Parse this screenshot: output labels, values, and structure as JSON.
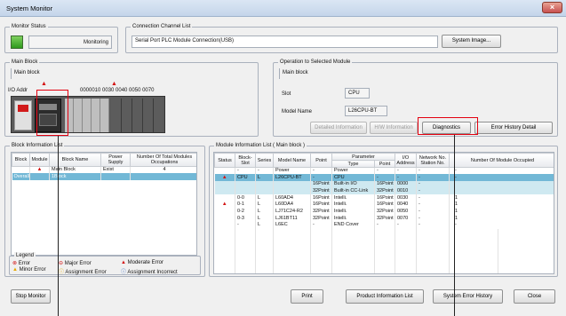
{
  "window": {
    "title": "System Monitor",
    "close_glyph": "×"
  },
  "monitor_status": {
    "label": "Monitor Status",
    "state": "Monitoring"
  },
  "connection": {
    "label": "Connection Channel List",
    "value": "Serial Port  PLC Module Connection(USB)",
    "system_image_button": "System Image..."
  },
  "main_block": {
    "label": "Main Block",
    "field": "Main block",
    "io_address_prefix": "I/O Addr",
    "io_address": "0000010 0030 0040 0050 0070"
  },
  "operation": {
    "label": "Operation to Selected Module",
    "field": "Main block",
    "slot_label": "Slot",
    "slot_value": "CPU",
    "model_label": "Model Name",
    "model_value": "L26CPU-BT",
    "buttons": {
      "detailed": "Detailed Information",
      "hw": "H/W Information",
      "diagnostics": "Diagnostics",
      "error_history": "Error History Detail"
    }
  },
  "block_list": {
    "label": "Block Information List",
    "headers": [
      "Block",
      "Module",
      "Block Name",
      "Power Supply",
      "Number Of Total Modules Occupations"
    ],
    "rows": [
      {
        "block": "",
        "module": "warn",
        "name": "Main Block",
        "supply": "Exist",
        "total": "4"
      },
      {
        "block": "Overall",
        "module": "",
        "name": "1Block",
        "supply": "",
        "total": ""
      }
    ]
  },
  "module_list": {
    "label": "Module Information List ( Main block )",
    "headers": {
      "status": "Status",
      "block_slot": "Block-Slot",
      "series": "Series",
      "model": "Model Name",
      "point": "Point",
      "parameter": "Parameter",
      "type": "Type",
      "param_point": "Point",
      "io_address": "I/O Address",
      "network_no": "Network No. Station No.",
      "occupied": "Number Of Module Occupied"
    },
    "rows": [
      {
        "status": "",
        "slot": "-",
        "series": "-",
        "model": "Power",
        "point": "-",
        "type": "Power",
        "ppoint": "-",
        "io": "-",
        "net": "-",
        "occ": "-",
        "style": ""
      },
      {
        "status": "warn",
        "slot": "CPU",
        "series": "L",
        "model": "L26CPU-BT",
        "point": "-",
        "type": "CPU",
        "ppoint": "-",
        "io": "-",
        "net": "-",
        "occ": "-",
        "style": "sel"
      },
      {
        "status": "",
        "slot": "",
        "series": "",
        "model": "",
        "point": "16Point",
        "type": "Built-in I/O",
        "ppoint": "16Point",
        "io": "0000",
        "net": "-",
        "occ": "",
        "style": "err"
      },
      {
        "status": "",
        "slot": "",
        "series": "",
        "model": "",
        "point": "32Point",
        "type": "Built-in CC-Link",
        "ppoint": "32Point",
        "io": "0010",
        "net": "-",
        "occ": "",
        "style": "err"
      },
      {
        "status": "",
        "slot": "0-0",
        "series": "L",
        "model": "L60AD4",
        "point": "16Point",
        "type": "Intelli.",
        "ppoint": "16Point",
        "io": "0030",
        "net": "-",
        "occ": "1",
        "style": ""
      },
      {
        "status": "warn",
        "slot": "0-1",
        "series": "L",
        "model": "L60DA4",
        "point": "16Point",
        "type": "Intelli.",
        "ppoint": "16Point",
        "io": "0040",
        "net": "-",
        "occ": "1",
        "style": ""
      },
      {
        "status": "",
        "slot": "0-2",
        "series": "L",
        "model": "LJ71C24-R2",
        "point": "32Point",
        "type": "Intelli.",
        "ppoint": "32Point",
        "io": "0050",
        "net": "-",
        "occ": "1",
        "style": ""
      },
      {
        "status": "",
        "slot": "0-3",
        "series": "L",
        "model": "LJ61BT11",
        "point": "32Point",
        "type": "Intelli.",
        "ppoint": "32Point",
        "io": "0070",
        "net": "-",
        "occ": "1",
        "style": ""
      },
      {
        "status": "",
        "slot": "-",
        "series": "L",
        "model": "L6EC",
        "point": "-",
        "type": "END Cover",
        "ppoint": "-",
        "io": "-",
        "net": "-",
        "occ": "-",
        "style": ""
      }
    ]
  },
  "legend": {
    "label": "Legend",
    "items": [
      {
        "text": "Error",
        "icon": "error-icon"
      },
      {
        "text": "Major Error",
        "icon": "major-error-icon"
      },
      {
        "text": "Moderate Error",
        "icon": "moderate-error-icon"
      },
      {
        "text": "Minor Error",
        "icon": "minor-error-icon"
      },
      {
        "text": "Assignment Error",
        "icon": "assignment-error-icon"
      },
      {
        "text": "Assignment Incorrect",
        "icon": "assignment-incorrect-icon"
      }
    ]
  },
  "bottom_buttons": {
    "stop_monitor": "Stop Monitor",
    "print": "Print",
    "product_info": "Product Information List",
    "system_error_history": "System Error History",
    "close": "Close"
  },
  "colors": {
    "callout": "#e3000f",
    "selected_row": "#72b8d6",
    "error_row": "#cfe9f1"
  }
}
